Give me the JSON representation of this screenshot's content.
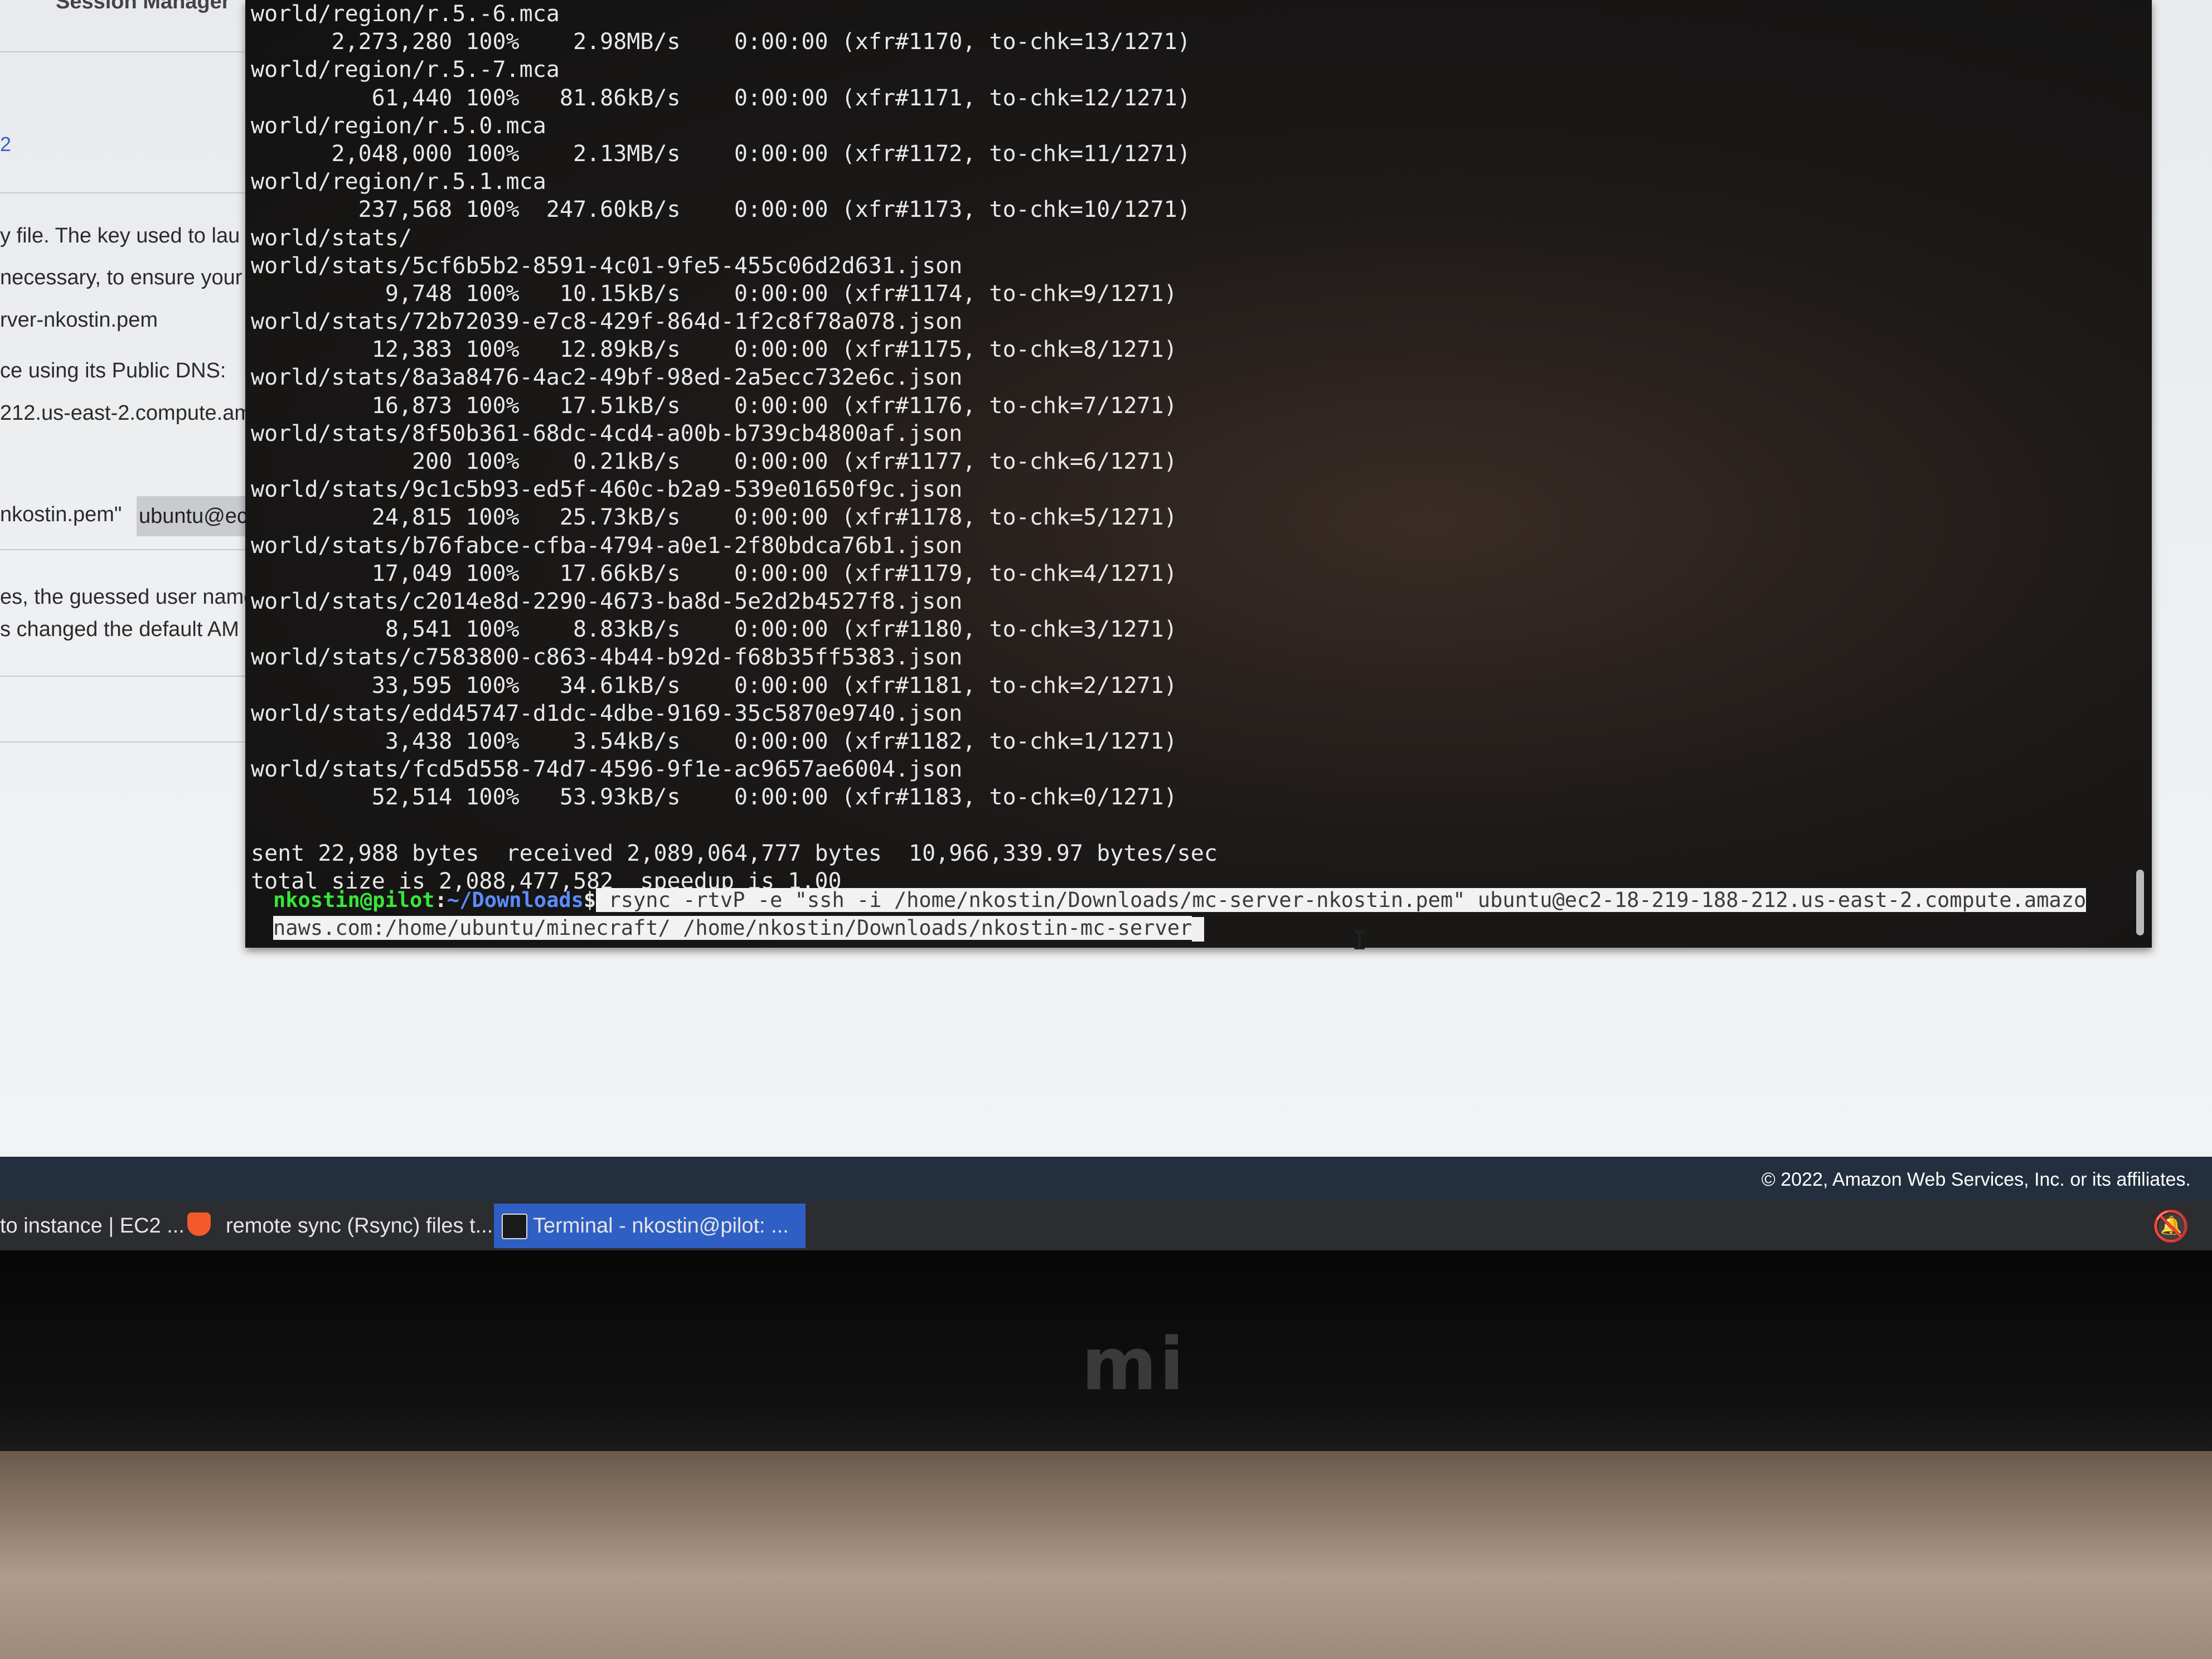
{
  "browser": {
    "session_manager": "Session Manager",
    "link_fragment": "2",
    "text_lines": [
      "y file. The key used to lau",
      "necessary, to ensure your",
      "rver-nkostin.pem",
      "ce using its Public DNS:",
      "212.us-east-2.compute.am",
      "nkostin.pem\"",
      "es, the guessed user name",
      "s changed the default AM"
    ],
    "code_snippet": "ubuntu@ec",
    "footer_copyright": "© 2022, Amazon Web Services, Inc. or its affiliates."
  },
  "terminal": {
    "lines": [
      "world/region/r.5.-6.mca",
      "      2,273,280 100%    2.98MB/s    0:00:00 (xfr#1170, to-chk=13/1271)",
      "world/region/r.5.-7.mca",
      "         61,440 100%   81.86kB/s    0:00:00 (xfr#1171, to-chk=12/1271)",
      "world/region/r.5.0.mca",
      "      2,048,000 100%    2.13MB/s    0:00:00 (xfr#1172, to-chk=11/1271)",
      "world/region/r.5.1.mca",
      "        237,568 100%  247.60kB/s    0:00:00 (xfr#1173, to-chk=10/1271)",
      "world/stats/",
      "world/stats/5cf6b5b2-8591-4c01-9fe5-455c06d2d631.json",
      "          9,748 100%   10.15kB/s    0:00:00 (xfr#1174, to-chk=9/1271)",
      "world/stats/72b72039-e7c8-429f-864d-1f2c8f78a078.json",
      "         12,383 100%   12.89kB/s    0:00:00 (xfr#1175, to-chk=8/1271)",
      "world/stats/8a3a8476-4ac2-49bf-98ed-2a5ecc732e6c.json",
      "         16,873 100%   17.51kB/s    0:00:00 (xfr#1176, to-chk=7/1271)",
      "world/stats/8f50b361-68dc-4cd4-a00b-b739cb4800af.json",
      "            200 100%    0.21kB/s    0:00:00 (xfr#1177, to-chk=6/1271)",
      "world/stats/9c1c5b93-ed5f-460c-b2a9-539e01650f9c.json",
      "         24,815 100%   25.73kB/s    0:00:00 (xfr#1178, to-chk=5/1271)",
      "world/stats/b76fabce-cfba-4794-a0e1-2f80bdca76b1.json",
      "         17,049 100%   17.66kB/s    0:00:00 (xfr#1179, to-chk=4/1271)",
      "world/stats/c2014e8d-2290-4673-ba8d-5e2d2b4527f8.json",
      "          8,541 100%    8.83kB/s    0:00:00 (xfr#1180, to-chk=3/1271)",
      "world/stats/c7583800-c863-4b44-b92d-f68b35ff5383.json",
      "         33,595 100%   34.61kB/s    0:00:00 (xfr#1181, to-chk=2/1271)",
      "world/stats/edd45747-d1dc-4dbe-9169-35c5870e9740.json",
      "          3,438 100%    3.54kB/s    0:00:00 (xfr#1182, to-chk=1/1271)",
      "world/stats/fcd5d558-74d7-4596-9f1e-ac9657ae6004.json",
      "         52,514 100%   53.93kB/s    0:00:00 (xfr#1183, to-chk=0/1271)",
      "",
      "sent 22,988 bytes  received 2,089,064,777 bytes  10,966,339.97 bytes/sec",
      "total size is 2,088,477,582  speedup is 1.00"
    ],
    "prompt_user": "nkostin@pilot",
    "prompt_sep": ":",
    "prompt_path": "~/Downloads",
    "prompt_dollar": "$",
    "command_line1": " rsync -rtvP -e \"ssh -i /home/nkostin/Downloads/mc-server-nkostin.pem\" ubuntu@ec2-18-219-188-212.us-east-2.compute.amazo",
    "command_line2": "naws.com:/home/ubuntu/minecraft/ /home/nkostin/Downloads/nkostin-mc-server"
  },
  "taskbar": {
    "items": [
      {
        "label": "to instance | EC2 ..."
      },
      {
        "label": "remote sync (Rsync) files t..."
      },
      {
        "label": "Terminal - nkostin@pilot: ..."
      }
    ]
  },
  "hardware": {
    "logo": "mi"
  }
}
